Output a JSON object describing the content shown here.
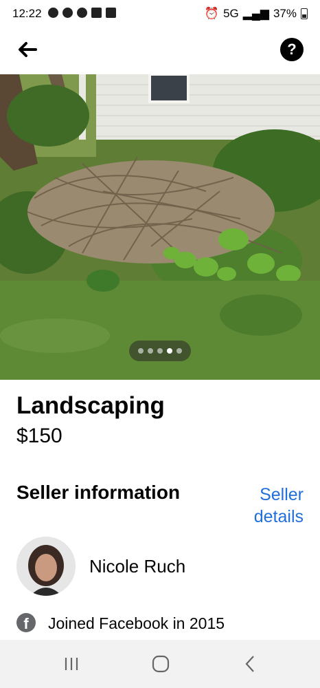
{
  "status_bar": {
    "time": "12:22",
    "network": "5G",
    "battery": "37%"
  },
  "listing": {
    "title": "Landscaping",
    "price": "$150",
    "photo_count": 5,
    "current_photo": 4
  },
  "seller": {
    "section_title": "Seller information",
    "details_link": "Seller details",
    "name": "Nicole Ruch",
    "joined": "Joined Facebook in 2015"
  },
  "icons": {
    "back": "arrow-left-icon",
    "help": "question-mark-icon",
    "facebook": "facebook-icon"
  },
  "colors": {
    "link": "#216fdb",
    "nav_bar": "#f2f2f2"
  }
}
